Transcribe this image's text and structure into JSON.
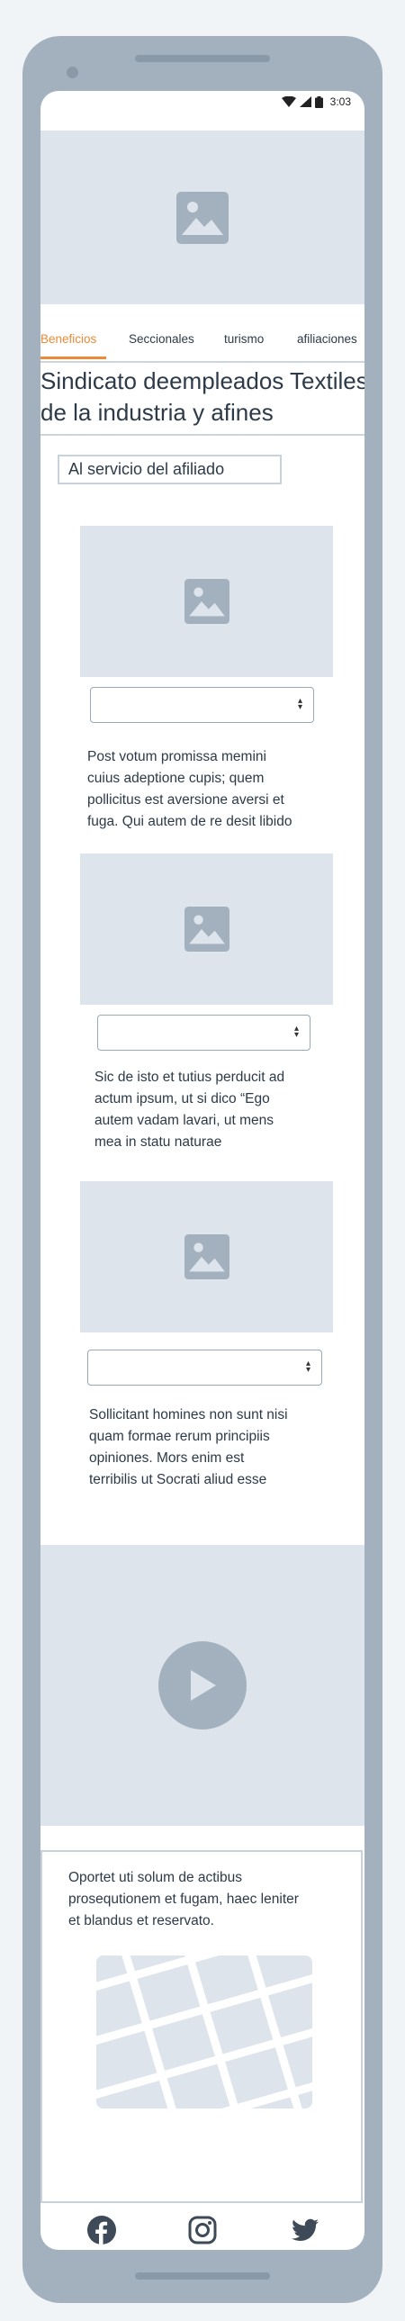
{
  "status_bar": {
    "time": "3:03"
  },
  "tabs": [
    {
      "label": "Beneficios",
      "active": true
    },
    {
      "label": "Seccionales",
      "active": false
    },
    {
      "label": "turismo",
      "active": false
    },
    {
      "label": "afiliaciones",
      "active": false
    }
  ],
  "page_title": {
    "line1": "Sindicato deempleados Textiles",
    "line2": "de la industria y afines"
  },
  "subtitle": "Al servicio del afiliado",
  "cards": [
    {
      "lines": [
        "Post votum promissa memini",
        "cuius adeptione cupis; quem",
        "pollicitus est aversione aversi et",
        "fuga. Qui autem de re desit libido"
      ]
    },
    {
      "lines": [
        "Sic de isto et tutius perducit ad",
        "actum ipsum, ut si dico “Ego",
        "autem vadam lavari, ut mens",
        "mea in statu naturae"
      ]
    },
    {
      "lines": [
        "Sollicitant homines non sunt nisi",
        "quam formae rerum principiis",
        "opiniones. Mors enim est",
        "terribilis ut Socrati aliud esse"
      ]
    }
  ],
  "footer": {
    "lines": [
      "Oportet uti solum de actibus",
      "prosequtionem et fugam, haec leniter",
      "et blandus et reservato."
    ]
  },
  "icons": {
    "wifi": "wifi-icon",
    "signal": "signal-icon",
    "battery": "battery-icon",
    "image": "image-placeholder-icon",
    "play": "play-icon",
    "facebook": "facebook-icon",
    "instagram": "instagram-icon",
    "twitter": "twitter-icon"
  },
  "colors": {
    "accent": "#ec8a35",
    "placeholder": "#dee4eb",
    "frame": "#a3b1bf",
    "text": "#2d3a48"
  }
}
